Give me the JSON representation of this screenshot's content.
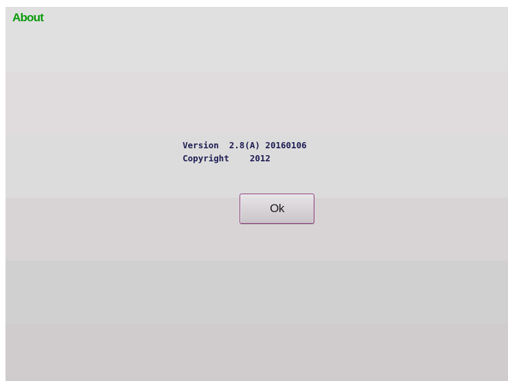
{
  "window": {
    "title": "About",
    "title_color": "#0a9a0a"
  },
  "about": {
    "version_label": "Version",
    "version_value": "2.8(A) 20160106",
    "copyright_label": "Copyright",
    "copyright_value": "2012"
  },
  "buttons": {
    "ok_label": "Ok"
  },
  "colors": {
    "text_color": "#1c1c52",
    "button_border": "#8a3a78",
    "background_bands": [
      "#e0e0e0",
      "#e0dcde",
      "#dcdcdc",
      "#d8d4d6",
      "#d0d0d0",
      "#d0ccce"
    ]
  }
}
